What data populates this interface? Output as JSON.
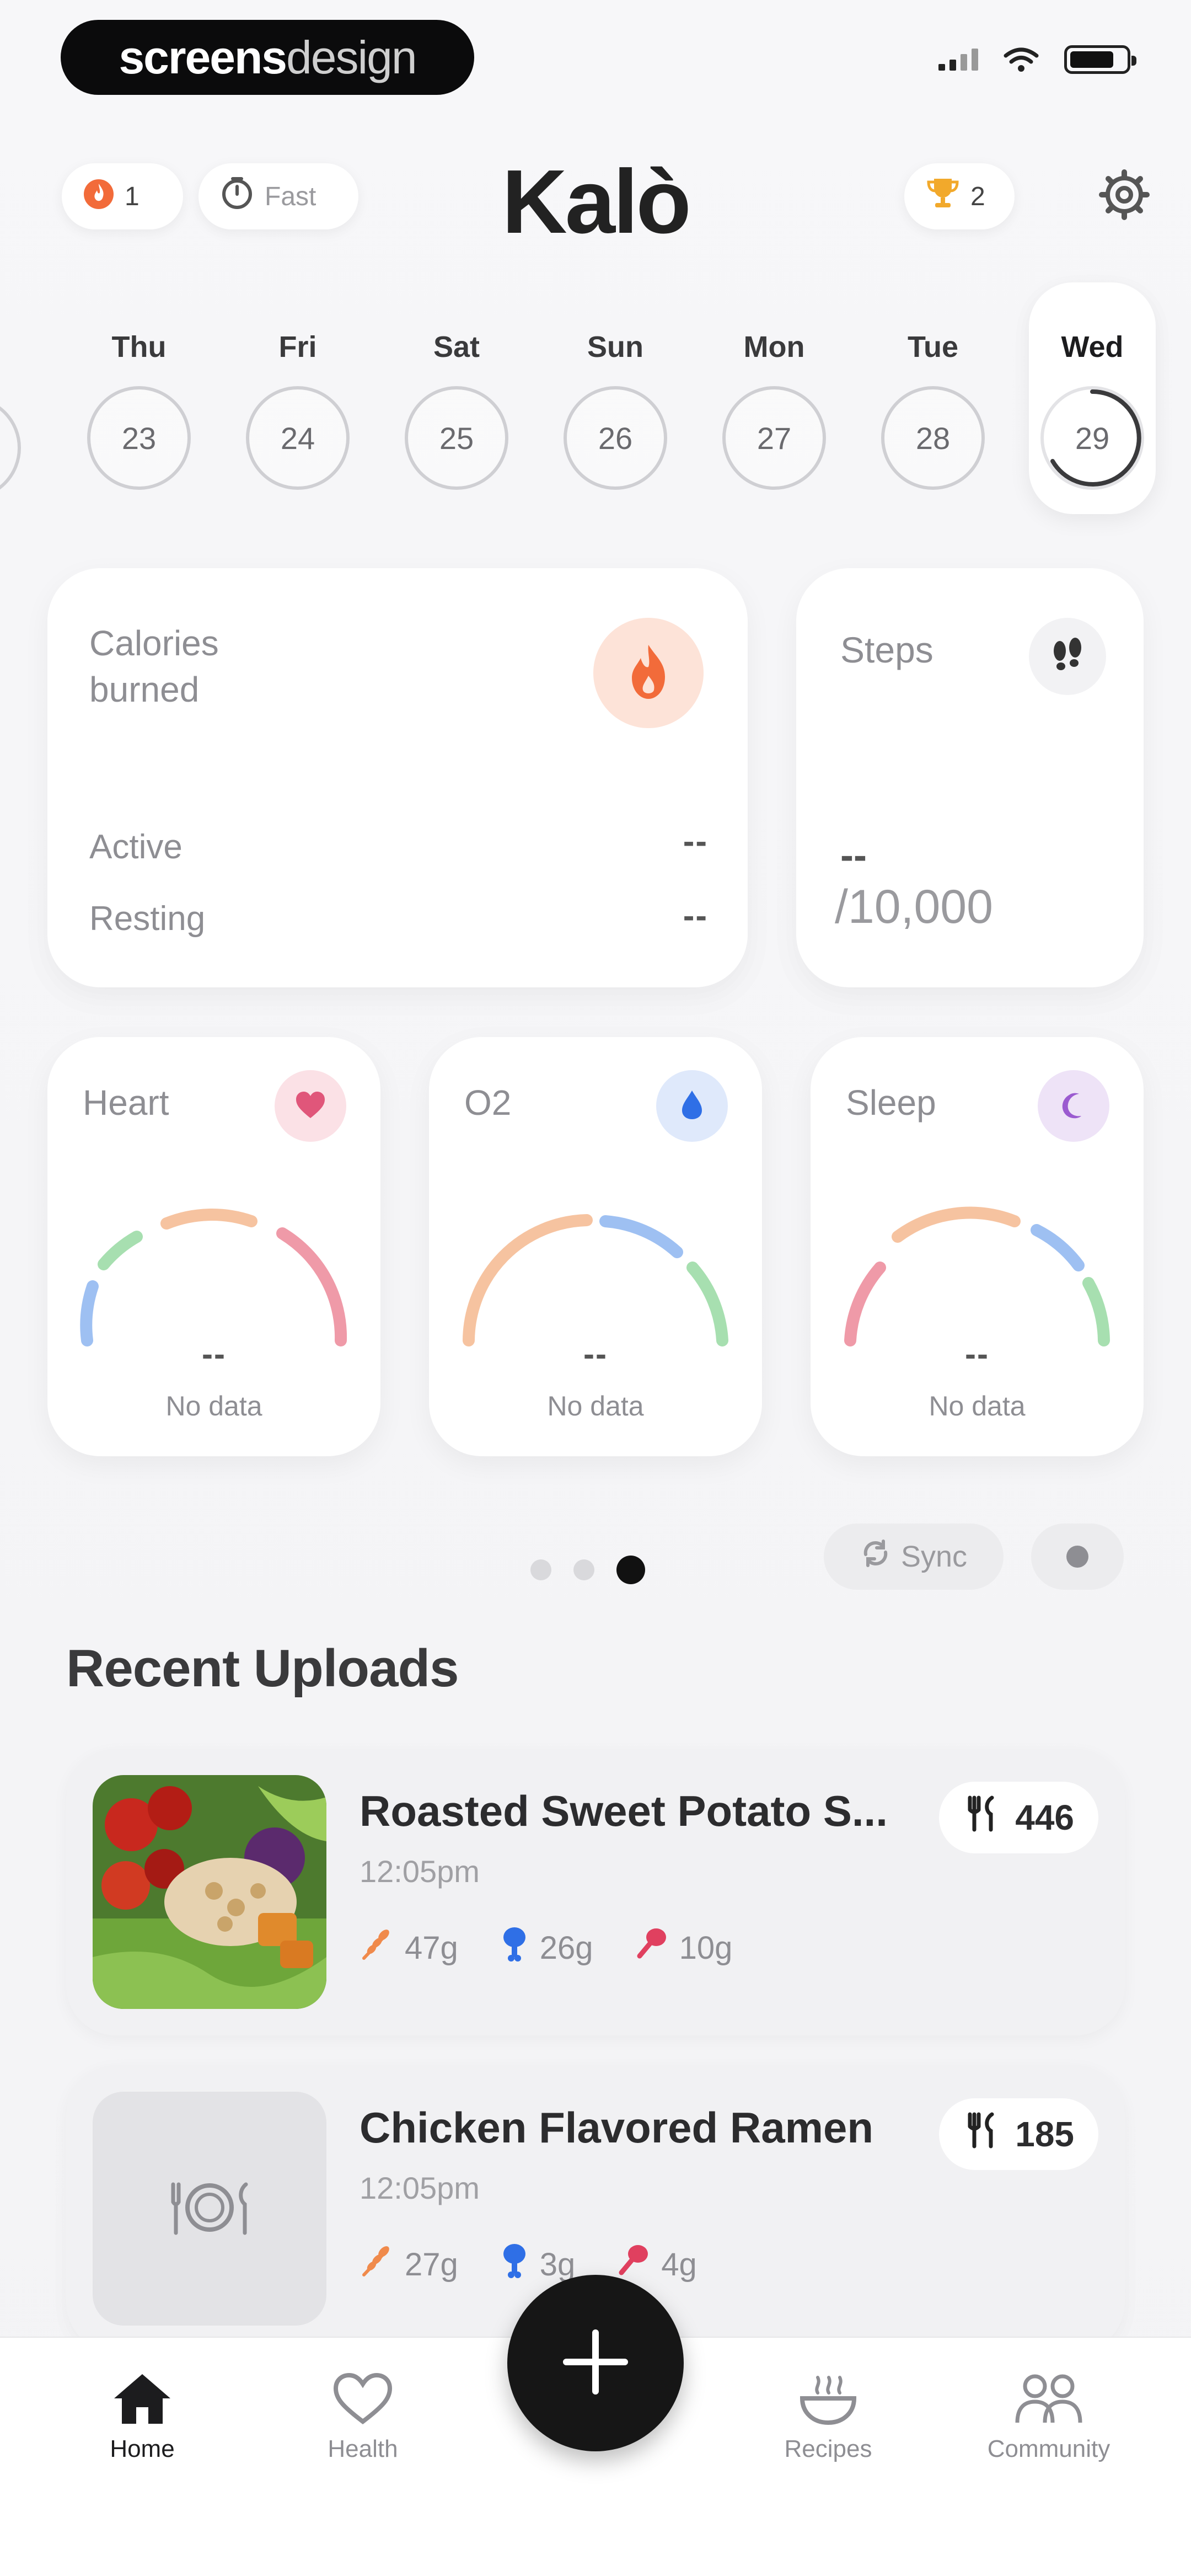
{
  "status_bar": {
    "brand_bold": "screens",
    "brand_light": "design"
  },
  "header": {
    "logo": "Kalò",
    "streak_count": "1",
    "fast_label": "Fast",
    "trophy_count": "2"
  },
  "days": [
    {
      "name": "Thu",
      "date": "23"
    },
    {
      "name": "Fri",
      "date": "24"
    },
    {
      "name": "Sat",
      "date": "25"
    },
    {
      "name": "Sun",
      "date": "26"
    },
    {
      "name": "Mon",
      "date": "27"
    },
    {
      "name": "Tue",
      "date": "28"
    },
    {
      "name": "Wed",
      "date": "29",
      "selected": true
    }
  ],
  "calories_card": {
    "title": "Calories burned",
    "active_label": "Active",
    "active_value": "--",
    "resting_label": "Resting",
    "resting_value": "--"
  },
  "steps_card": {
    "title": "Steps",
    "value": "--",
    "goal": "/10,000"
  },
  "metrics": [
    {
      "title": "Heart",
      "value": "--",
      "status": "No data",
      "badge_color": "#fbe1e6",
      "icon_color": "#e0567a"
    },
    {
      "title": "O2",
      "value": "--",
      "status": "No data",
      "badge_color": "#dfe9fb",
      "icon_color": "#2f6fe6"
    },
    {
      "title": "Sleep",
      "value": "--",
      "status": "No data",
      "badge_color": "#eee3f7",
      "icon_color": "#9b5bd0"
    }
  ],
  "pager": {
    "pages": 3,
    "active_index": 2
  },
  "sync": {
    "label": "Sync"
  },
  "recent": {
    "title": "Recent Uploads",
    "items": [
      {
        "name": "Roasted Sweet Potato S...",
        "time": "12:05pm",
        "calories": "446",
        "carbs": "47g",
        "protein": "26g",
        "fat": "10g"
      },
      {
        "name": "Chicken Flavored Ramen",
        "time": "12:05pm",
        "calories": "185",
        "carbs": "27g",
        "protein": "3g",
        "fat": "4g"
      }
    ]
  },
  "nav": {
    "home": "Home",
    "health": "Health",
    "recipes": "Recipes",
    "community": "Community"
  },
  "colors": {
    "carbs": "#f08a4b",
    "protein": "#2f6fe6",
    "fat": "#e0405f",
    "gauge_blue": "#9ec0f2",
    "gauge_green": "#a7dfb0",
    "gauge_orange": "#f6c3a0",
    "gauge_red": "#ef9aa8"
  }
}
